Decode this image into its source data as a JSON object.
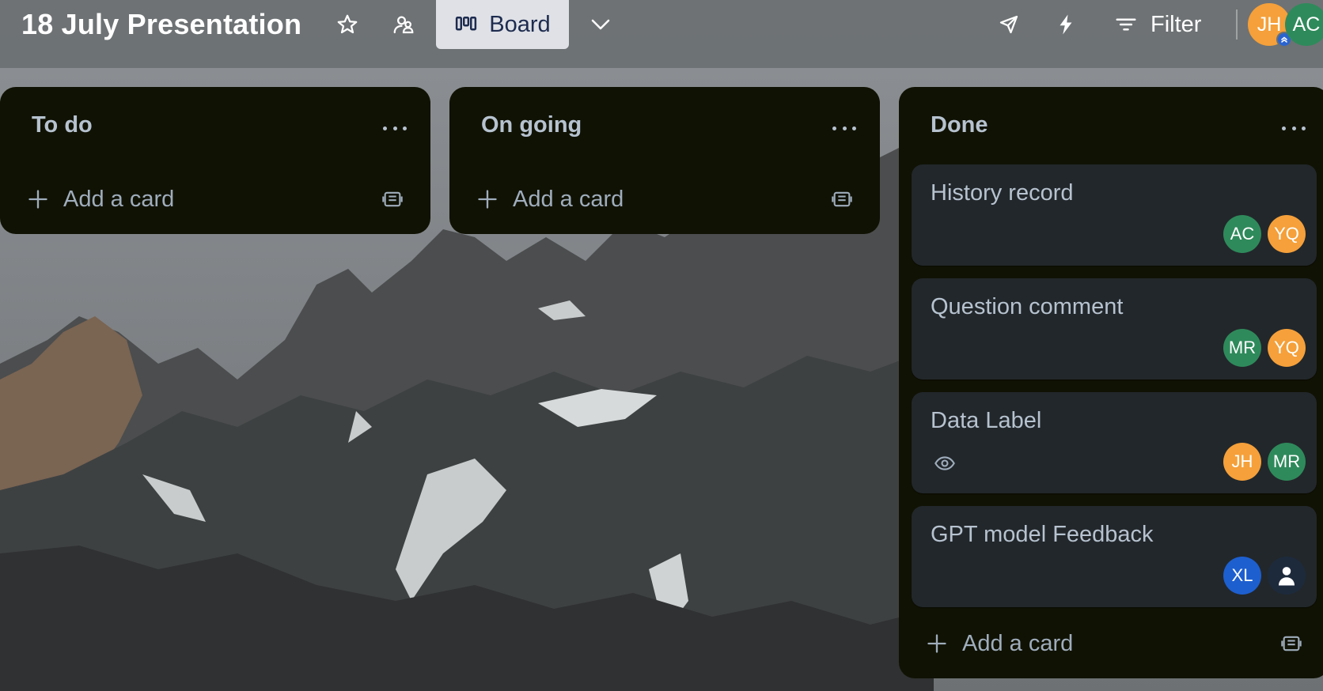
{
  "board": {
    "title": "18 July Presentation",
    "view_label": "Board",
    "filter_label": "Filter",
    "icons": [
      "star-icon",
      "workspace-visible-icon",
      "board-view-icon",
      "chevron-down-icon",
      "power-ups-icon",
      "automation-icon",
      "filter-icon"
    ]
  },
  "header_members": [
    {
      "initials": "JH",
      "color": "#f5a03a",
      "admin": true
    },
    {
      "initials": "AC",
      "color": "#2f8a5b"
    }
  ],
  "lists": [
    {
      "name": "To do",
      "add_card_label": "Add a card",
      "cards": []
    },
    {
      "name": "On going",
      "add_card_label": "Add a card",
      "cards": []
    },
    {
      "name": "Done",
      "add_card_label": "Add a card",
      "cards": [
        {
          "title": "History record",
          "watching": false,
          "members": [
            {
              "initials": "AC",
              "color": "#2f8a5b"
            },
            {
              "initials": "YQ",
              "color": "#f5a03a"
            }
          ]
        },
        {
          "title": "Question comment",
          "watching": false,
          "members": [
            {
              "initials": "MR",
              "color": "#2f8a5b"
            },
            {
              "initials": "YQ",
              "color": "#f5a03a"
            }
          ]
        },
        {
          "title": "Data Label",
          "watching": true,
          "members": [
            {
              "initials": "JH",
              "color": "#f5a03a"
            },
            {
              "initials": "MR",
              "color": "#2f8a5b"
            }
          ]
        },
        {
          "title": "GPT model Feedback",
          "watching": false,
          "members": [
            {
              "initials": "XL",
              "color": "#1d5fcf"
            },
            {
              "initials": "",
              "color": "#1d2a3c",
              "placeholder": true
            }
          ]
        }
      ]
    }
  ]
}
